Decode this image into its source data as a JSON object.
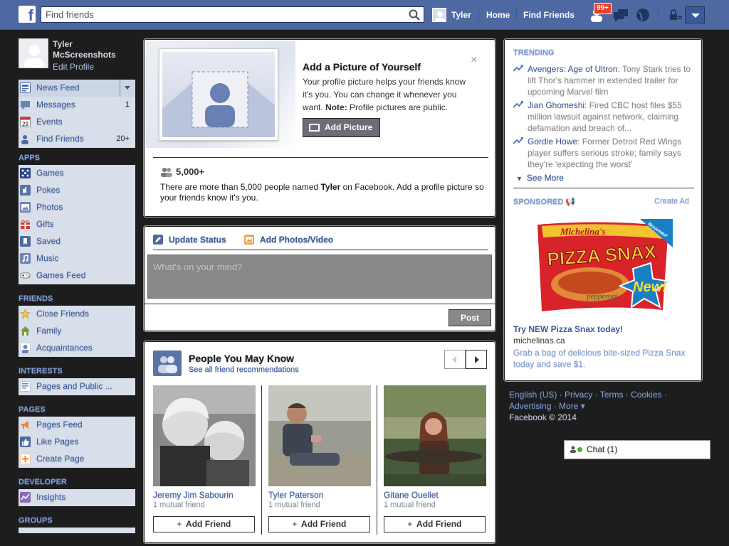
{
  "header": {
    "logo": "f",
    "search_placeholder": "Find friends",
    "user_name": "Tyler",
    "nav": [
      "Home",
      "Find Friends"
    ],
    "notification_badge": "99+"
  },
  "sidebar": {
    "profile_name_line1": "Tyler",
    "profile_name_line2": "McScreenshots",
    "edit_profile": "Edit Profile",
    "favorites": [
      {
        "label": "News Feed",
        "icon": "news-feed-icon",
        "count": ""
      },
      {
        "label": "Messages",
        "icon": "messages-icon",
        "count": "1"
      },
      {
        "label": "Events",
        "icon": "calendar-icon",
        "count": "",
        "icon_text": "29"
      },
      {
        "label": "Find Friends",
        "icon": "find-friends-icon",
        "count": "20+"
      }
    ],
    "apps_head": "APPS",
    "apps": [
      {
        "label": "Games",
        "icon": "games-icon"
      },
      {
        "label": "Pokes",
        "icon": "pokes-icon"
      },
      {
        "label": "Photos",
        "icon": "photos-icon"
      },
      {
        "label": "Gifts",
        "icon": "gifts-icon"
      },
      {
        "label": "Saved",
        "icon": "saved-icon"
      },
      {
        "label": "Music",
        "icon": "music-icon"
      },
      {
        "label": "Games Feed",
        "icon": "games-feed-icon"
      }
    ],
    "friends_head": "FRIENDS",
    "friends": [
      {
        "label": "Close Friends",
        "icon": "star-icon"
      },
      {
        "label": "Family",
        "icon": "house-icon"
      },
      {
        "label": "Acquaintances",
        "icon": "acquaintances-icon"
      }
    ],
    "interests_head": "INTERESTS",
    "interests": [
      {
        "label": "Pages and Public ...",
        "icon": "pages-feed-icon"
      }
    ],
    "pages_head": "PAGES",
    "pages": [
      {
        "label": "Pages Feed",
        "icon": "megaphone-icon"
      },
      {
        "label": "Like Pages",
        "icon": "thumbs-up-icon"
      },
      {
        "label": "Create Page",
        "icon": "plus-icon"
      }
    ],
    "developer_head": "DEVELOPER",
    "developer": [
      {
        "label": "Insights",
        "icon": "insights-icon"
      }
    ],
    "groups_head": "GROUPS"
  },
  "picture_prompt": {
    "title": "Add a Picture of Yourself",
    "body": "Your profile picture helps your friends know it's you. You can change it whenever you want.",
    "note_label": "Note:",
    "note_text": " Profile pictures are public.",
    "button": "Add Picture",
    "close": "×",
    "count": "5,000+",
    "count_text_1": "There are more than 5,000 people named ",
    "count_name": "Tyler",
    "count_text_2": " on Facebook. Add a profile picture so your friends know it's you."
  },
  "composer": {
    "tab_status": "Update Status",
    "tab_photos": "Add Photos/Video",
    "placeholder": "What's on your mind?",
    "post": "Post"
  },
  "pymk": {
    "title": "People You May Know",
    "see_all": "See all friend recommendations",
    "people": [
      {
        "name": "Jeremy Jim Sabourin",
        "mutual": "1 mutual friend",
        "button": "Add Friend"
      },
      {
        "name": "Tyler Paterson",
        "mutual": "1 mutual friend",
        "button": "Add Friend"
      },
      {
        "name": "Gitane Ouellet",
        "mutual": "1 mutual friend",
        "button": "Add Friend"
      }
    ]
  },
  "trending": {
    "head": "TRENDING",
    "items": [
      {
        "topic": "Avengers: Age of Ultron",
        "text": ": Tony Stark tries to lift Thor's hammer in extended trailer for upcoming Marvel film"
      },
      {
        "topic": "Jian Ghomeshi",
        "text": ": Fired CBC host files $55 million lawsuit against network, claiming defamation and breach of..."
      },
      {
        "topic": "Gordie Howe",
        "text": ": Former Detroit Red Wings player suffers serious stroke; family says they're 'expecting the worst'"
      }
    ],
    "see_more": "See More"
  },
  "ad": {
    "sponsored": "SPONSORED",
    "create_ad": "Create Ad",
    "brand": "Michelina's",
    "product": "PIZZA SNAX",
    "flavor": "pepperoni",
    "burst": "New!",
    "corner": "Nouveau!",
    "title": "Try NEW Pizza Snax today!",
    "domain": "michelinas.ca",
    "desc": "Grab a bag of delicious bite-sized Pizza Snax today and save $1."
  },
  "footer": {
    "links_1": "English (US) · Privacy · Terms · Cookies ·",
    "links_2": "Advertising · More ▾",
    "copyright": "Facebook © 2014"
  },
  "chat": {
    "label": "Chat (1)"
  }
}
